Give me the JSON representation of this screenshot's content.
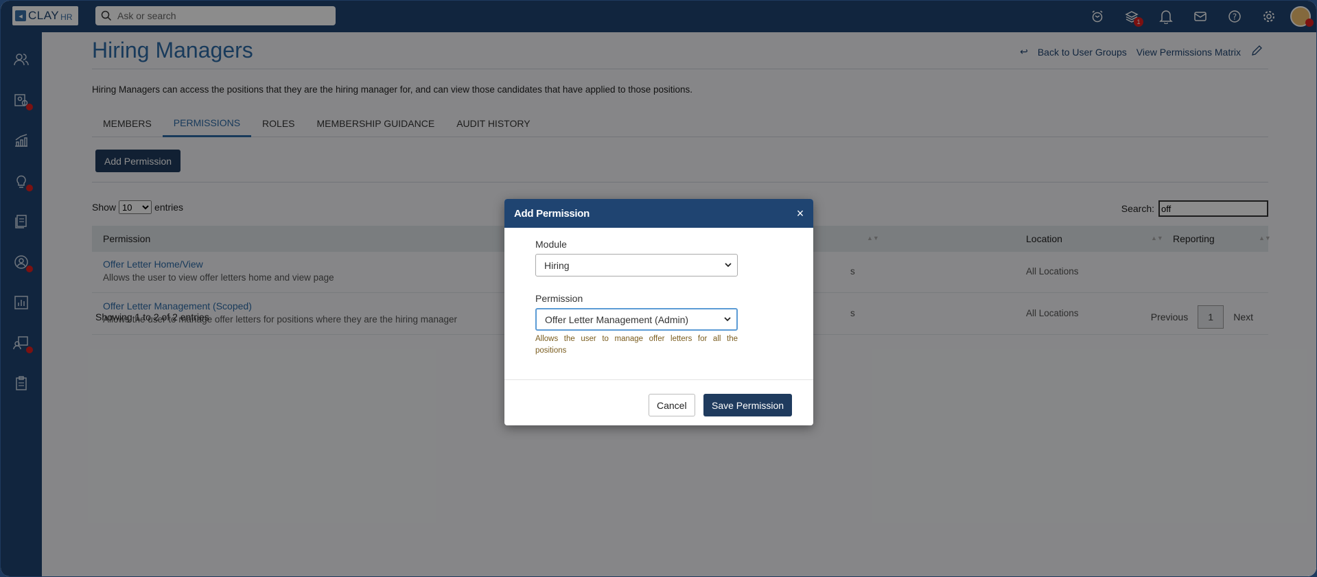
{
  "app": {
    "logo_text": "CLAY",
    "logo_suffix": "HR",
    "search_placeholder": "Ask or search"
  },
  "topbar": {
    "layers_badge": "1",
    "avatar_badge": "0"
  },
  "page": {
    "title": "Hiring Managers",
    "back_link": "Back to User Groups",
    "matrix_link": "View Permissions Matrix",
    "description": "Hiring Managers can access the positions that they are the hiring manager for, and can view those candidates that have applied to those positions."
  },
  "tabs": [
    {
      "label": "MEMBERS"
    },
    {
      "label": "PERMISSIONS"
    },
    {
      "label": "ROLES"
    },
    {
      "label": "MEMBERSHIP GUIDANCE"
    },
    {
      "label": "AUDIT HISTORY"
    }
  ],
  "toolbar": {
    "add_permission": "Add Permission",
    "show_label": "Show",
    "entries_value": "10",
    "entries_label": "entries",
    "search_label": "Search:",
    "search_value": "off"
  },
  "table": {
    "headers": [
      "Permission",
      "Location",
      "Reporting"
    ],
    "rows": [
      {
        "name": "Offer Letter Home/View",
        "desc": "Allows the user to view offer letters home and view page",
        "partial": "s",
        "location": "All Locations"
      },
      {
        "name": "Offer Letter Management (Scoped)",
        "desc": "Allows the user to manage offer letters for positions where they are the hiring manager",
        "partial": "s",
        "location": "All Locations"
      }
    ],
    "info": "Showing 1 to 2 of 2 entries",
    "prev": "Previous",
    "page": "1",
    "next": "Next"
  },
  "modal": {
    "title": "Add Permission",
    "close": "×",
    "module_label": "Module",
    "module_value": "Hiring",
    "permission_label": "Permission",
    "permission_value": "Offer Letter Management (Admin)",
    "permission_hint": "Allows the user to manage offer letters for all the positions",
    "cancel": "Cancel",
    "save": "Save Permission"
  },
  "colors": {
    "brand": "#1f4471",
    "link": "#2d6aa7",
    "badge": "#e02020"
  }
}
